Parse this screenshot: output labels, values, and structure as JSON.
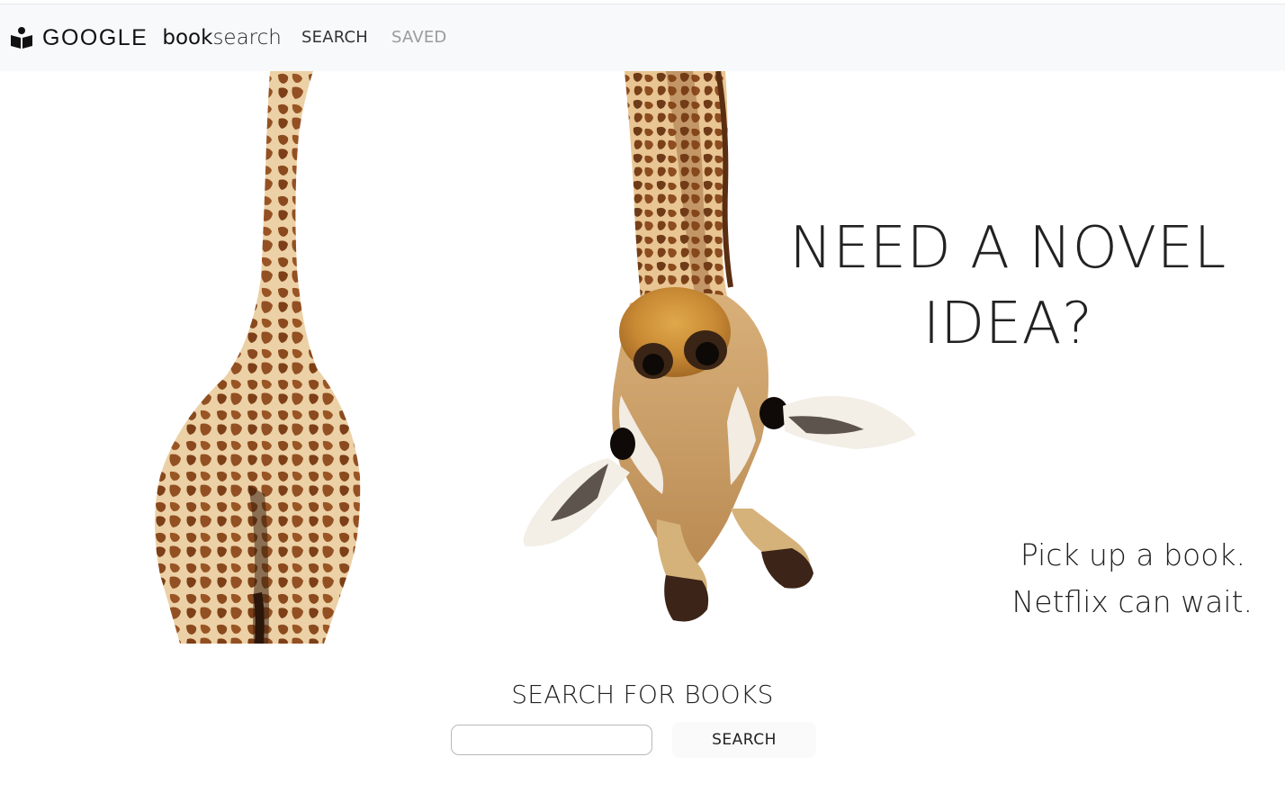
{
  "navbar": {
    "brand_google": "GOOGLE",
    "brand_book": "book",
    "brand_search": "search",
    "links": {
      "search": "SEARCH",
      "saved": "SAVED"
    },
    "icon": "book-reader-icon"
  },
  "hero": {
    "headline_line1": "NEED A NOVEL",
    "headline_line2": "IDEA?",
    "tagline_line1": "Pick up a book.",
    "tagline_line2": "Netflix can wait."
  },
  "search": {
    "title": "SEARCH FOR BOOKS",
    "input_value": "",
    "input_placeholder": "",
    "button_label": "SEARCH"
  },
  "colors": {
    "navbar_bg": "#f8f9fa",
    "text": "#222222",
    "muted_link": "#9a9a9a",
    "giraffe_base": "#e9c79a",
    "giraffe_spots": "#8b4a1c"
  }
}
